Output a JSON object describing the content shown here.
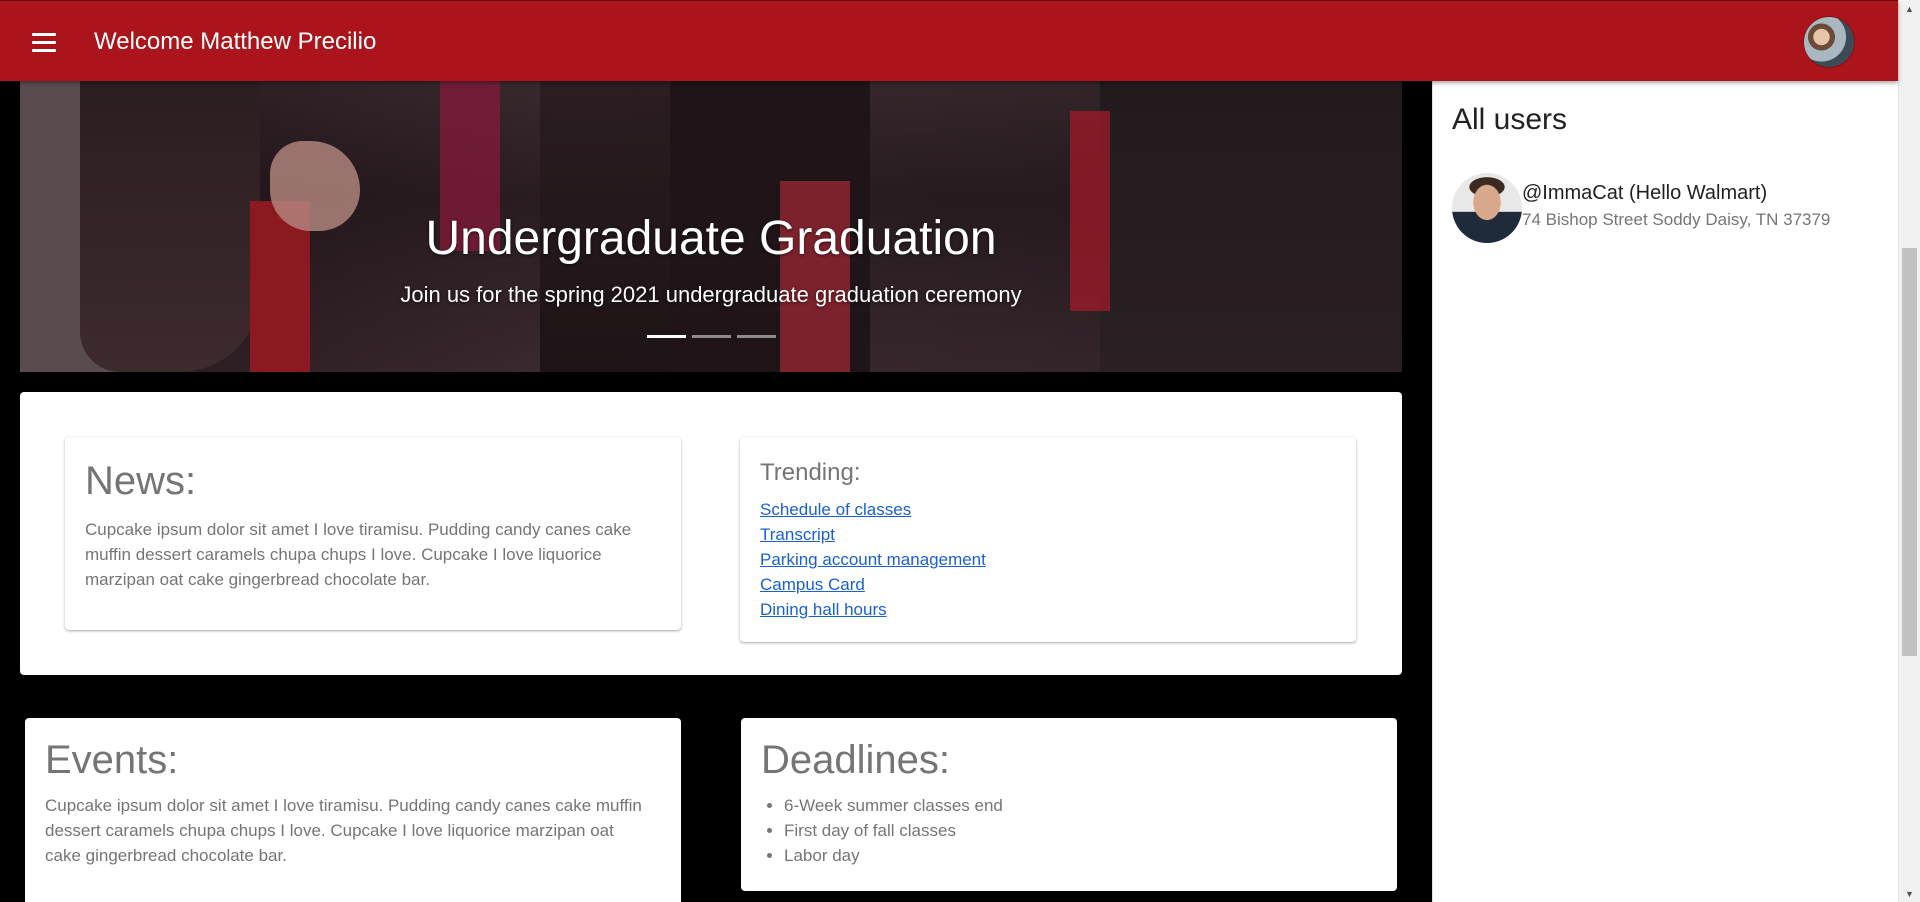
{
  "header": {
    "title": "Welcome Matthew Precilio",
    "menu_icon": "hamburger-menu-icon",
    "accent_color": "#ac141b"
  },
  "carousel": {
    "title": "Undergraduate Graduation",
    "subtitle": "Join us for the spring 2021 undergraduate graduation ceremony",
    "active_index": 0,
    "slide_count": 3
  },
  "news": {
    "title": "News:",
    "body": "Cupcake ipsum dolor sit amet I love tiramisu. Pudding candy canes cake muffin dessert caramels chupa chups I love. Cupcake I love liquorice marzipan oat cake gingerbread chocolate bar."
  },
  "trending": {
    "title": "Trending:",
    "links": [
      "Schedule of classes",
      "Transcript",
      "Parking account management",
      "Campus Card",
      "Dining hall hours"
    ]
  },
  "events": {
    "title": "Events:",
    "body": "Cupcake ipsum dolor sit amet I love tiramisu. Pudding candy canes cake muffin dessert caramels chupa chups I love. Cupcake I love liquorice marzipan oat cake gingerbread chocolate bar."
  },
  "deadlines": {
    "title": "Deadlines:",
    "items": [
      "6-Week summer classes end",
      "First day of fall classes",
      "Labor day"
    ]
  },
  "sidebar": {
    "title": "All users",
    "users": [
      {
        "name": "@ImmaCat (Hello Walmart)",
        "address": "74 Bishop Street Soddy Daisy, TN 37379"
      }
    ]
  }
}
